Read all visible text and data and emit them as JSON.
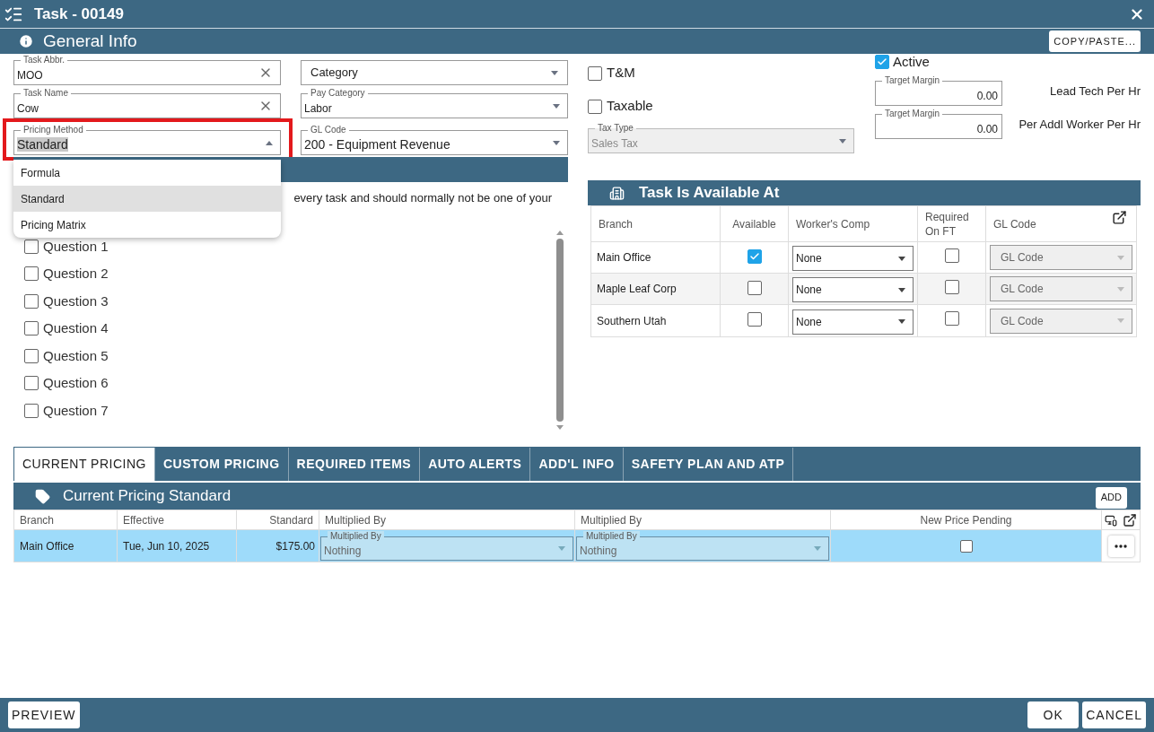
{
  "window": {
    "title": "Task - 00149"
  },
  "general_info": {
    "title": "General Info",
    "copy_paste_button": "COPY/PASTE..."
  },
  "fields": {
    "task_abbr": {
      "label": "Task Abbr.",
      "value": "MOO"
    },
    "task_name": {
      "label": "Task Name",
      "value": "Cow"
    },
    "pricing_method": {
      "label": "Pricing Method",
      "value": "Standard",
      "expanded": true,
      "highlighted": true
    },
    "category": {
      "placeholder": "Category"
    },
    "pay_category": {
      "label": "Pay Category",
      "value": "Labor"
    },
    "gl_code": {
      "label": "GL Code",
      "value": "200 - Equipment Revenue"
    }
  },
  "pricing_method_options": [
    {
      "label": "Formula",
      "selected": false
    },
    {
      "label": "Standard",
      "selected": true
    },
    {
      "label": "Pricing Matrix",
      "selected": false
    }
  ],
  "checkboxes": [
    {
      "label": "T&M",
      "checked": false
    },
    {
      "label": "Taxable",
      "checked": false
    }
  ],
  "tax_type": {
    "label": "Tax Type",
    "value": "Sales Tax",
    "disabled": true
  },
  "active": {
    "label": "Active",
    "checked": true
  },
  "target_margins": [
    {
      "label": "Target Margin",
      "value": "0.00",
      "caption": "Lead Tech Per Hr"
    },
    {
      "label": "Target Margin",
      "value": "0.00",
      "caption": "Per Addl Worker Per Hr"
    }
  ],
  "questions_section": {
    "note": "every task and should normally not be one of your",
    "questions": [
      {
        "label": "Question 1",
        "checked": false
      },
      {
        "label": "Question 2",
        "checked": false
      },
      {
        "label": "Question 3",
        "checked": false
      },
      {
        "label": "Question 4",
        "checked": false
      },
      {
        "label": "Question 5",
        "checked": false
      },
      {
        "label": "Question 6",
        "checked": false
      },
      {
        "label": "Question 7",
        "checked": false
      }
    ]
  },
  "availability": {
    "title": "Task Is Available At",
    "columns": [
      "Branch",
      "Available",
      "Worker's Comp",
      "Required On FT",
      "GL Code"
    ],
    "rows": [
      {
        "branch": "Main Office",
        "available": true,
        "workers_comp": "None",
        "required_on_ft": false,
        "gl_code": {
          "placeholder": "GL Code",
          "disabled": true
        }
      },
      {
        "branch": "Maple Leaf Corp",
        "available": false,
        "workers_comp": "None",
        "required_on_ft": false,
        "gl_code": {
          "placeholder": "GL Code",
          "disabled": true
        }
      },
      {
        "branch": "Southern Utah",
        "available": false,
        "workers_comp": "None",
        "required_on_ft": false,
        "gl_code": {
          "placeholder": "GL Code",
          "disabled": true
        }
      }
    ]
  },
  "tabs": [
    {
      "label": "CURRENT PRICING",
      "selected": true
    },
    {
      "label": "CUSTOM PRICING",
      "selected": false
    },
    {
      "label": "REQUIRED ITEMS",
      "selected": false
    },
    {
      "label": "AUTO ALERTS",
      "selected": false
    },
    {
      "label": "ADD'L INFO",
      "selected": false
    },
    {
      "label": "SAFETY PLAN AND ATP",
      "selected": false
    }
  ],
  "pricing": {
    "title": "Current Pricing Standard",
    "add_button": "ADD",
    "columns": [
      "Branch",
      "Effective",
      "Standard",
      "Multiplied By",
      "Multiplied By",
      "New Price Pending"
    ],
    "rows": [
      {
        "branch": "Main Office",
        "effective": "Tue, Jun 10, 2025",
        "standard": "$175.00",
        "multiplied_by": [
          {
            "label": "Multiplied By",
            "value": "Nothing"
          },
          {
            "label": "Multiplied By",
            "value": "Nothing"
          }
        ],
        "new_price_pending": false,
        "selected": true
      }
    ]
  },
  "footer": {
    "preview_button": "PREVIEW",
    "ok_button": "OK",
    "cancel_button": "CANCEL"
  }
}
